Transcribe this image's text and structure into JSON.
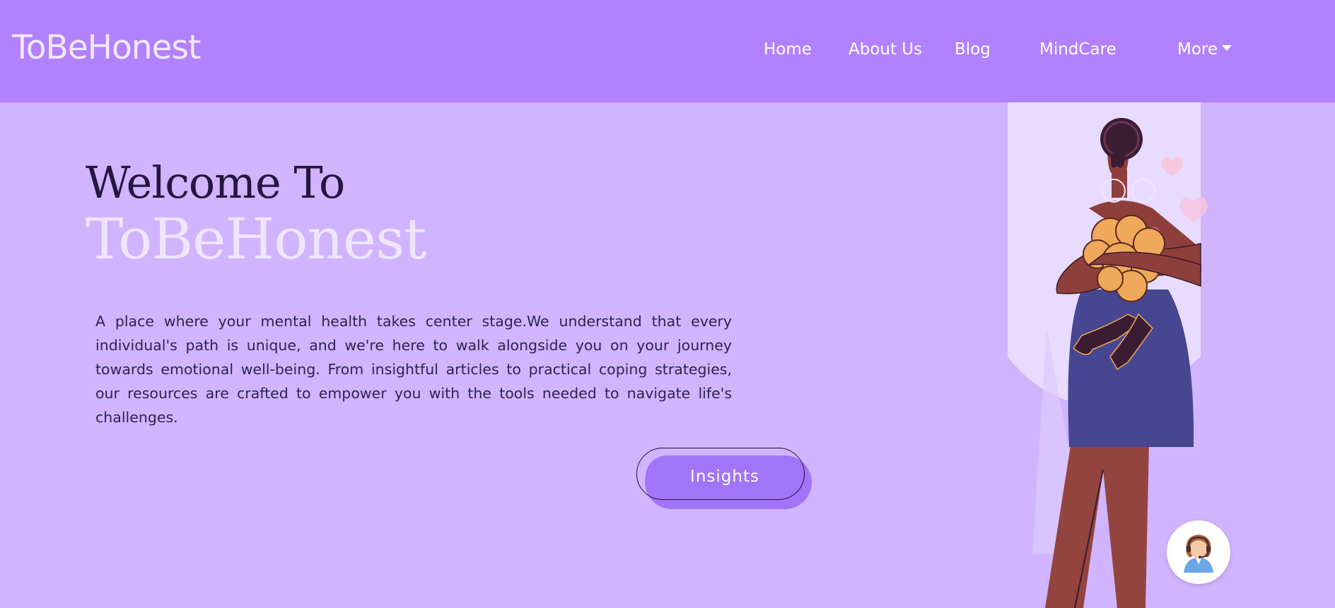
{
  "header": {
    "brand": "ToBeHonest",
    "nav": [
      {
        "label": "Home"
      },
      {
        "label": "About Us"
      },
      {
        "label": "Blog"
      },
      {
        "label": "MindCare"
      },
      {
        "label": "More",
        "icon": "caret-down-icon"
      }
    ]
  },
  "hero": {
    "welcome": "Welcome To",
    "brand": "ToBeHonest",
    "description": "A place where your mental health takes center stage.We understand that every individual's path is unique, and we're here to walk alongside you on your journey towards emotional well-being. From insightful articles to practical coping strategies, our resources are crafted to empower you with the tools needed to navigate life's challenges.",
    "cta_label": "Insights",
    "illustration": "woman-holding-brain-illustration"
  },
  "chat": {
    "icon": "support-agent-icon"
  },
  "colors": {
    "navbar": "#b281fe",
    "background": "#d0b4fe",
    "accent": "#a274f7",
    "heading": "#24163f",
    "brand_light": "#efe5ff"
  }
}
